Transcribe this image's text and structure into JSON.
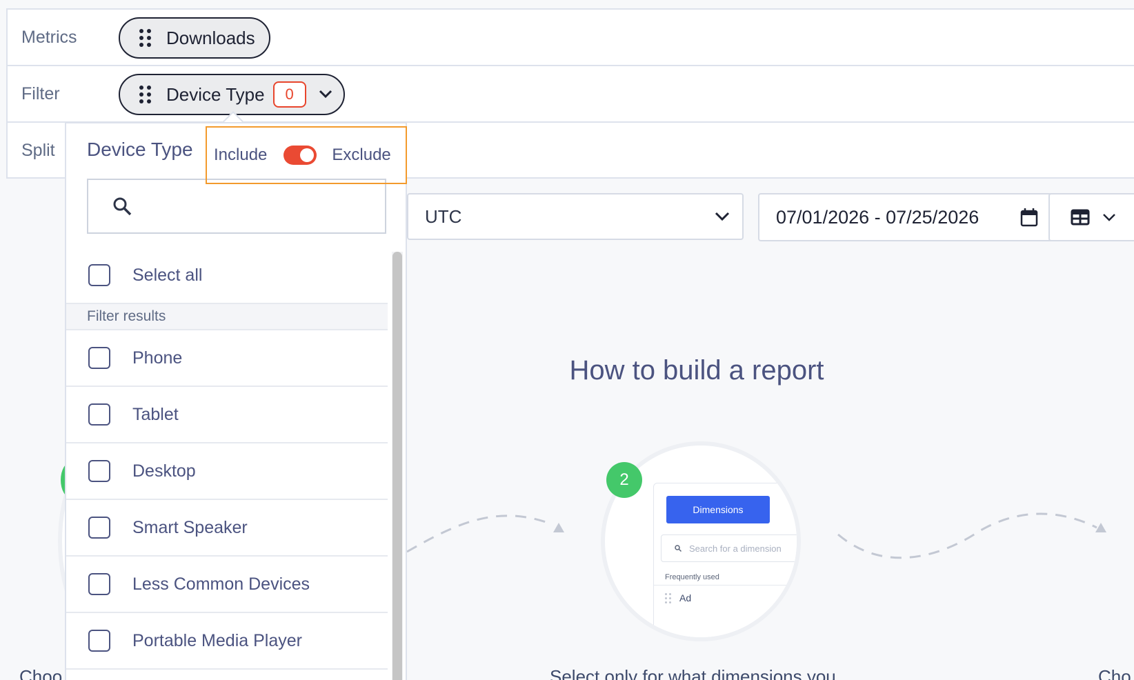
{
  "builder": {
    "metrics_label": "Metrics",
    "filter_label": "Filter",
    "split_label": "Split",
    "metric_pill": "Downloads",
    "filter_pill": "Device Type",
    "filter_count": "0"
  },
  "dropdown": {
    "title": "Device Type",
    "include_label": "Include",
    "exclude_label": "Exclude",
    "toggle_state": "exclude",
    "search_placeholder": "",
    "select_all": "Select all",
    "section_label": "Filter results",
    "options": [
      "Phone",
      "Tablet",
      "Desktop",
      "Smart Speaker",
      "Less Common Devices",
      "Portable Media Player"
    ]
  },
  "toolbar": {
    "timezone": "UTC",
    "date_range": "07/01/2026 - 07/25/2026"
  },
  "howto": {
    "title": "How to build a report",
    "step_number": "2",
    "mini_tab": "Dimensions",
    "mini_search_placeholder": "Search for a dimension",
    "mini_section": "Frequently used",
    "mini_item": "Ad",
    "step_text": "Select only for what dimensions you",
    "left_text": "Choo",
    "right_text": "Cho"
  },
  "colors": {
    "accent_red": "#ea4a33",
    "highlight_orange": "#f39a2c",
    "step_green": "#44c86a",
    "tab_blue": "#3763ee"
  }
}
